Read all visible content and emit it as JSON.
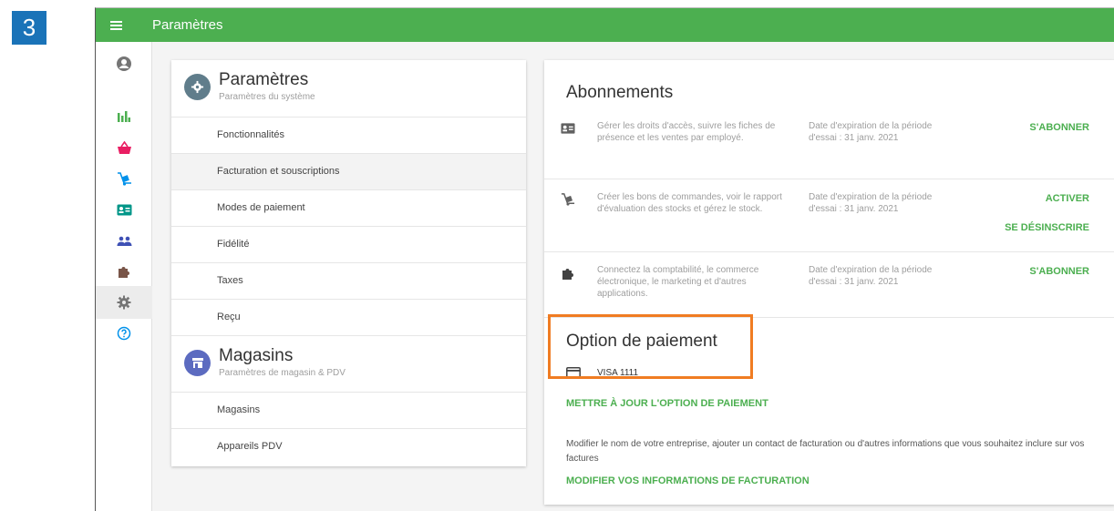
{
  "step_number": "3",
  "topbar": {
    "title": "Paramètres",
    "menu_icon": "hamburger-icon"
  },
  "sidebar": {
    "items": [
      {
        "name": "account",
        "icon": "user-circle-icon",
        "color": "#757575"
      },
      {
        "name": "reports",
        "icon": "bar-chart-icon",
        "color": "#4caf50"
      },
      {
        "name": "sales",
        "icon": "basket-icon",
        "color": "#e91e63"
      },
      {
        "name": "inventory",
        "icon": "hand-truck-icon",
        "color": "#0091ea"
      },
      {
        "name": "employees",
        "icon": "id-card-icon",
        "color": "#009688"
      },
      {
        "name": "customers",
        "icon": "people-icon",
        "color": "#3f51b5"
      },
      {
        "name": "integrations",
        "icon": "puzzle-icon",
        "color": "#795548"
      },
      {
        "name": "settings",
        "icon": "gear-icon",
        "color": "#757575",
        "active": true
      },
      {
        "name": "help",
        "icon": "question-circle-icon",
        "color": "#0091ea"
      }
    ]
  },
  "settings_panel": {
    "title": "Paramètres",
    "subtitle": "Paramètres du système",
    "items": [
      "Fonctionnalités",
      "Facturation et souscriptions",
      "Modes de paiement",
      "Fidélité",
      "Taxes",
      "Reçu"
    ],
    "selected_index": 1
  },
  "stores_panel": {
    "title": "Magasins",
    "subtitle": "Paramètres de magasin & PDV",
    "items": [
      "Magasins",
      "Appareils PDV"
    ]
  },
  "subscriptions": {
    "title": "Abonnements",
    "rows": [
      {
        "icon": "id-card-icon",
        "description": "Gérer les droits d'accès, suivre les fiches de présence et les ventes par employé.",
        "expiration": "Date d'expiration de la période d'essai : 31 janv. 2021",
        "actions": [
          "S'ABONNER"
        ]
      },
      {
        "icon": "hand-truck-icon",
        "description": "Créer les bons de commandes, voir le rapport d'évaluation des stocks et gérez le stock.",
        "expiration": "Date d'expiration de la période d'essai : 31 janv. 2021",
        "actions": [
          "ACTIVER",
          "SE DÉSINSCRIRE"
        ]
      },
      {
        "icon": "puzzle-icon",
        "description": "Connectez la comptabilité, le commerce électronique, le marketing et d'autres applications.",
        "expiration": "Date d'expiration de la période d'essai : 31 janv. 2021",
        "actions": [
          "S'ABONNER"
        ]
      }
    ]
  },
  "payment": {
    "title": "Option de paiement",
    "card_icon": "credit-card-icon",
    "card_label": "VISA 1111",
    "update_link": "METTRE À JOUR L'OPTION DE PAIEMENT",
    "info": "Modifier le nom de votre entreprise, ajouter un contact de facturation ou d'autres informations que vous souhaitez inclure sur vos factures",
    "billing_link": "MODIFIER VOS INFORMATIONS DE FACTURATION"
  },
  "colors": {
    "accent": "#4caf50",
    "highlight": "#f07c22",
    "badge": "#1a73b8"
  }
}
